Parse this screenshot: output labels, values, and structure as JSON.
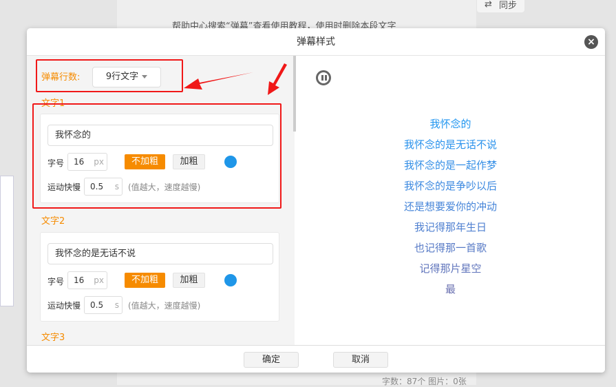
{
  "background": {
    "help_text": "帮助中心搜索“弹幕”查看使用教程，使用时删除本段文字",
    "sync_label": "同步",
    "status_text": "字数：87个   图片：0张"
  },
  "modal": {
    "title": "弹幕样式",
    "row_count_label": "弹幕行数:",
    "row_count_value": "9行文字",
    "texts": [
      {
        "label": "文字1",
        "value": "我怀念的",
        "size_label": "字号",
        "size": "16",
        "size_unit": "px",
        "normal_label": "不加粗",
        "bold_label": "加粗",
        "color": "#1f96e8",
        "speed_label": "运动快慢",
        "speed": "0.5",
        "speed_unit": "s",
        "speed_hint": "(值越大，速度越慢)"
      },
      {
        "label": "文字2",
        "value": "我怀念的是无话不说",
        "size_label": "字号",
        "size": "16",
        "size_unit": "px",
        "normal_label": "不加粗",
        "bold_label": "加粗",
        "color": "#1f96e8",
        "speed_label": "运动快慢",
        "speed": "0.5",
        "speed_unit": "s",
        "speed_hint": "(值越大，速度越慢)"
      },
      {
        "label": "文字3"
      }
    ],
    "preview_lines": [
      {
        "text": "我怀念的",
        "color": "#2196f0"
      },
      {
        "text": "我怀念的是无话不说",
        "color": "#2a92ec"
      },
      {
        "text": "我怀念的是一起作梦",
        "color": "#338ee6"
      },
      {
        "text": "我怀念的是争吵以后",
        "color": "#3c89e0"
      },
      {
        "text": "还是想要爱你的冲动",
        "color": "#4584d8"
      },
      {
        "text": "我记得那年生日",
        "color": "#4e7fd0"
      },
      {
        "text": "也记得那一首歌",
        "color": "#577ac6"
      },
      {
        "text": "记得那片星空",
        "color": "#6075bc"
      },
      {
        "text": "最",
        "color": "#6a70b0"
      }
    ],
    "confirm_label": "确定",
    "cancel_label": "取消"
  }
}
